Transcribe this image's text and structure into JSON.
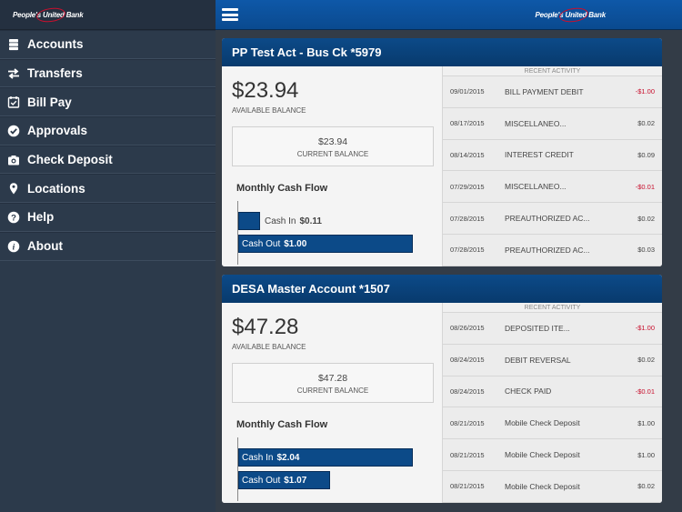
{
  "brand": {
    "name": "People's United Bank"
  },
  "colors": {
    "primary": "#0c4a88",
    "sidebar": "#2c3a4b",
    "negative": "#c8102e"
  },
  "menu": [
    {
      "label": "Accounts",
      "icon": "accounts-icon"
    },
    {
      "label": "Transfers",
      "icon": "transfers-icon"
    },
    {
      "label": "Bill Pay",
      "icon": "bill-pay-icon"
    },
    {
      "label": "Approvals",
      "icon": "approvals-icon"
    },
    {
      "label": "Check Deposit",
      "icon": "camera-icon"
    },
    {
      "label": "Locations",
      "icon": "location-pin-icon"
    },
    {
      "label": "Help",
      "icon": "help-icon"
    },
    {
      "label": "About",
      "icon": "info-icon"
    }
  ],
  "accounts": [
    {
      "title": "PP Test Act - Bus Ck *5979",
      "available": "$23.94",
      "available_label": "AVAILABLE BALANCE",
      "current": "$23.94",
      "current_label": "CURRENT BALANCE",
      "cash_flow_title": "Monthly Cash Flow",
      "cash_in_label": "Cash In",
      "cash_in": "$0.11",
      "cash_out_label": "Cash Out",
      "cash_out": "$1.00",
      "cash_in_value": 0.11,
      "cash_out_value": 1.0,
      "recent_label": "RECENT ACTIVITY",
      "transactions": [
        {
          "date": "09/01/2015",
          "desc": "BILL PAYMENT DEBIT",
          "amount": "-$1.00",
          "negative": true
        },
        {
          "date": "08/17/2015",
          "desc": "MISCELLANEO...",
          "amount": "$0.02",
          "negative": false
        },
        {
          "date": "08/14/2015",
          "desc": "INTEREST CREDIT",
          "amount": "$0.09",
          "negative": false
        },
        {
          "date": "07/29/2015",
          "desc": "MISCELLANEO...",
          "amount": "-$0.01",
          "negative": true
        },
        {
          "date": "07/28/2015",
          "desc": "PREAUTHORIZED AC...",
          "amount": "$0.02",
          "negative": false
        },
        {
          "date": "07/28/2015",
          "desc": "PREAUTHORIZED AC...",
          "amount": "$0.03",
          "negative": false
        }
      ]
    },
    {
      "title": "DESA Master Account *1507",
      "available": "$47.28",
      "available_label": "AVAILABLE BALANCE",
      "current": "$47.28",
      "current_label": "CURRENT BALANCE",
      "cash_flow_title": "Monthly Cash Flow",
      "cash_in_label": "Cash In",
      "cash_in": "$2.04",
      "cash_out_label": "Cash Out",
      "cash_out": "$1.07",
      "cash_in_value": 2.04,
      "cash_out_value": 1.07,
      "recent_label": "RECENT ACTIVITY",
      "transactions": [
        {
          "date": "08/26/2015",
          "desc": "DEPOSITED ITE...",
          "amount": "-$1.00",
          "negative": true
        },
        {
          "date": "08/24/2015",
          "desc": "DEBIT REVERSAL",
          "amount": "$0.02",
          "negative": false
        },
        {
          "date": "08/24/2015",
          "desc": "CHECK PAID",
          "amount": "-$0.01",
          "negative": true
        },
        {
          "date": "08/21/2015",
          "desc": "Mobile Check Deposit",
          "amount": "$1.00",
          "negative": false
        },
        {
          "date": "08/21/2015",
          "desc": "Mobile Check Deposit",
          "amount": "$1.00",
          "negative": false
        },
        {
          "date": "08/21/2015",
          "desc": "Mobile Check Deposit",
          "amount": "$0.02",
          "negative": false
        }
      ]
    }
  ]
}
